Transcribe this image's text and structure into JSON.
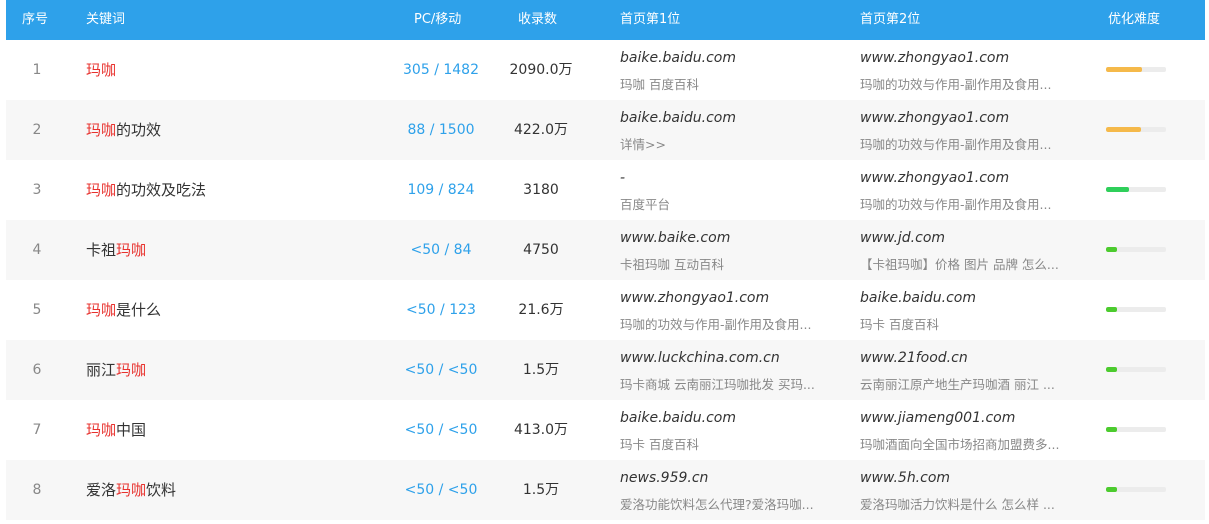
{
  "header": {
    "idx": "序号",
    "keyword": "关键词",
    "pc_mobile": "PC/移动",
    "records": "收录数",
    "site1": "首页第1位",
    "site2": "首页第2位",
    "difficulty": "优化难度"
  },
  "colors": {
    "header_bg": "#2ea1ea",
    "highlight": "#e8322e",
    "difficulty_high": "#f5b94a",
    "difficulty_mid": "#2fcf5a",
    "difficulty_low": "#4ccb2e"
  },
  "rows": [
    {
      "idx": "1",
      "kw_pre": "",
      "kw_hl": "玛咖",
      "kw_post": "",
      "pc": "305 / 1482",
      "records": "2090.0万",
      "site1": "baike.baidu.com",
      "desc1": "玛咖  百度百科",
      "site2": "www.zhongyao1.com",
      "desc2": "玛咖的功效与作用-副作用及食用...",
      "difficulty": 0.6,
      "color": "#f5b94a"
    },
    {
      "idx": "2",
      "kw_pre": "",
      "kw_hl": "玛咖",
      "kw_post": "的功效",
      "pc": "88 / 1500",
      "records": "422.0万",
      "site1": "baike.baidu.com",
      "desc1": "详情>>",
      "site2": "www.zhongyao1.com",
      "desc2": "玛咖的功效与作用-副作用及食用...",
      "difficulty": 0.58,
      "color": "#f5b94a"
    },
    {
      "idx": "3",
      "kw_pre": "",
      "kw_hl": "玛咖",
      "kw_post": "的功效及吃法",
      "pc": "109 / 824",
      "records": "3180",
      "site1": "-",
      "desc1": "百度平台",
      "site2": "www.zhongyao1.com",
      "desc2": "玛咖的功效与作用-副作用及食用...",
      "difficulty": 0.38,
      "color": "#2fcf5a"
    },
    {
      "idx": "4",
      "kw_pre": "卡祖",
      "kw_hl": "玛咖",
      "kw_post": "",
      "pc": "<50 / 84",
      "records": "4750",
      "site1": "www.baike.com",
      "desc1": "卡祖玛咖  互动百科",
      "site2": "www.jd.com",
      "desc2": "【卡祖玛咖】价格  图片  品牌  怎么...",
      "difficulty": 0.18,
      "color": "#4ccb2e"
    },
    {
      "idx": "5",
      "kw_pre": "",
      "kw_hl": "玛咖",
      "kw_post": "是什么",
      "pc": "<50 / 123",
      "records": "21.6万",
      "site1": "www.zhongyao1.com",
      "desc1": "玛咖的功效与作用-副作用及食用...",
      "site2": "baike.baidu.com",
      "desc2": "玛卡  百度百科",
      "difficulty": 0.18,
      "color": "#4ccb2e"
    },
    {
      "idx": "6",
      "kw_pre": "丽江",
      "kw_hl": "玛咖",
      "kw_post": "",
      "pc": "<50 / <50",
      "records": "1.5万",
      "site1": "www.luckchina.com.cn",
      "desc1": "玛卡商城  云南丽江玛咖批发  买玛...",
      "site2": "www.21food.cn",
      "desc2": "云南丽江原产地生产玛咖酒  丽江  ...",
      "difficulty": 0.18,
      "color": "#4ccb2e"
    },
    {
      "idx": "7",
      "kw_pre": "",
      "kw_hl": "玛咖",
      "kw_post": "中国",
      "pc": "<50 / <50",
      "records": "413.0万",
      "site1": "baike.baidu.com",
      "desc1": "玛卡  百度百科",
      "site2": "www.jiameng001.com",
      "desc2": "玛咖酒面向全国市场招商加盟费多...",
      "difficulty": 0.18,
      "color": "#4ccb2e"
    },
    {
      "idx": "8",
      "kw_pre": "爱洛",
      "kw_hl": "玛咖",
      "kw_post": "饮料",
      "pc": "<50 / <50",
      "records": "1.5万",
      "site1": "news.959.cn",
      "desc1": "爱洛功能饮料怎么代理?爱洛玛咖...",
      "site2": "www.5h.com",
      "desc2": "爱洛玛咖活力饮料是什么  怎么样  ...",
      "difficulty": 0.18,
      "color": "#4ccb2e"
    }
  ]
}
